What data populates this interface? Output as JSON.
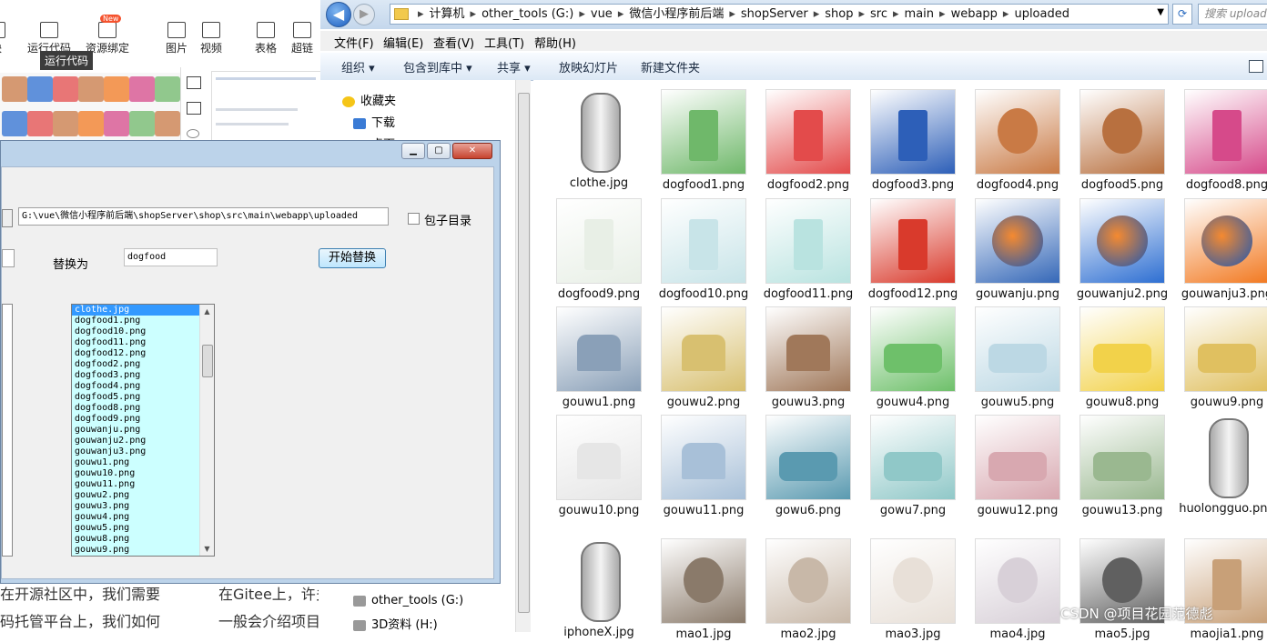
{
  "editor": {
    "toolbar": [
      {
        "label": "块",
        "icon": "block-icon"
      },
      {
        "label": "运行代码",
        "icon": "code-icon"
      },
      {
        "label": "资源绑定",
        "icon": "upload-icon",
        "badge": "New"
      },
      {
        "label": "图片",
        "icon": "image-icon"
      },
      {
        "label": "视频",
        "icon": "video-icon"
      },
      {
        "label": "表格",
        "icon": "table-icon"
      },
      {
        "label": "超链",
        "icon": "link-icon"
      }
    ],
    "tooltip": "运行代码",
    "text_left": [
      "在开源社区中，我们需要",
      "码托管平台上，我们如何"
    ],
    "text_mid": [
      "在Gitee上，许多",
      "一般会介绍项目"
    ]
  },
  "dialog": {
    "path_value": "G:\\vue\\微信小程序前后端\\shopServer\\shop\\src\\main\\webapp\\uploaded",
    "subdir_label": "包子目录",
    "replace_label": "替换为",
    "replace_value": "dogfood",
    "start_button": "开始替换",
    "file_list": [
      "clothe.jpg",
      "dogfood1.png",
      "dogfood10.png",
      "dogfood11.png",
      "dogfood12.png",
      "dogfood2.png",
      "dogfood3.png",
      "dogfood4.png",
      "dogfood5.png",
      "dogfood8.png",
      "dogfood9.png",
      "gouwanju.png",
      "gouwanju2.png",
      "gouwanju3.png",
      "gouwu1.png",
      "gouwu10.png",
      "gouwu11.png",
      "gouwu2.png",
      "gouwu3.png",
      "gouwu4.png",
      "gouwu5.png",
      "gouwu8.png",
      "gouwu9.png"
    ],
    "selected_index": 0
  },
  "explorer": {
    "breadcrumb": [
      "计算机",
      "other_tools (G:)",
      "vue",
      "微信小程序前后端",
      "shopServer",
      "shop",
      "src",
      "main",
      "webapp",
      "uploaded"
    ],
    "search_placeholder": "搜索 uploaded",
    "menu": [
      "文件(F)",
      "编辑(E)",
      "查看(V)",
      "工具(T)",
      "帮助(H)"
    ],
    "commands": [
      "组织 ▾",
      "包含到库中 ▾",
      "共享 ▾",
      "放映幻灯片",
      "新建文件夹"
    ],
    "nav": [
      {
        "label": "收藏夹",
        "icon": "star-icon"
      },
      {
        "label": "下载",
        "icon": "download-folder-icon"
      },
      {
        "label": "桌面",
        "icon": "desktop-icon"
      },
      {
        "label": "other_tools (G:)",
        "icon": "drive-icon"
      },
      {
        "label": "3D资料 (H:)",
        "icon": "drive-icon"
      }
    ],
    "files": [
      {
        "name": "clothe.jpg",
        "kind": "car"
      },
      {
        "name": "dogfood1.png",
        "kind": "food",
        "color": "#6fb86a"
      },
      {
        "name": "dogfood2.png",
        "kind": "food",
        "color": "#e34b4b"
      },
      {
        "name": "dogfood3.png",
        "kind": "food",
        "color": "#2d5fb8"
      },
      {
        "name": "dogfood4.png",
        "kind": "dog",
        "color": "#c97a45"
      },
      {
        "name": "dogfood5.png",
        "kind": "dog",
        "color": "#b8703f"
      },
      {
        "name": "dogfood8.png",
        "kind": "food",
        "color": "#d64a8a"
      },
      {
        "name": "dogfood9.png",
        "kind": "food",
        "color": "#e8efe6"
      },
      {
        "name": "dogfood10.png",
        "kind": "food",
        "color": "#c8e4e8"
      },
      {
        "name": "dogfood11.png",
        "kind": "food",
        "color": "#b9e3e0"
      },
      {
        "name": "dogfood12.png",
        "kind": "food",
        "color": "#d93a2c"
      },
      {
        "name": "gouwanju.png",
        "kind": "ball",
        "color": "#3568b8"
      },
      {
        "name": "gouwanju2.png",
        "kind": "ball",
        "color": "#2e6fd2"
      },
      {
        "name": "gouwanju3.png",
        "kind": "ball",
        "color": "#f27a22"
      },
      {
        "name": "gouwu1.png",
        "kind": "house",
        "color": "#8aa0b8"
      },
      {
        "name": "gouwu2.png",
        "kind": "house",
        "color": "#d8c070"
      },
      {
        "name": "gouwu3.png",
        "kind": "house",
        "color": "#a0785a"
      },
      {
        "name": "gouwu4.png",
        "kind": "bed",
        "color": "#6ec06a"
      },
      {
        "name": "gouwu5.png",
        "kind": "bed",
        "color": "#bcd8e4"
      },
      {
        "name": "gouwu8.png",
        "kind": "bed",
        "color": "#f2d24a"
      },
      {
        "name": "gouwu9.png",
        "kind": "bed",
        "color": "#e0c060"
      },
      {
        "name": "gouwu10.png",
        "kind": "house",
        "color": "#e6e6e6"
      },
      {
        "name": "gouwu11.png",
        "kind": "house",
        "color": "#a8c0d8"
      },
      {
        "name": "gowu6.png",
        "kind": "bed",
        "color": "#5a9ab0"
      },
      {
        "name": "gowu7.png",
        "kind": "bed",
        "color": "#90c8c8"
      },
      {
        "name": "gouwu12.png",
        "kind": "bed",
        "color": "#d8a8b0"
      },
      {
        "name": "gouwu13.png",
        "kind": "bed",
        "color": "#9ab890"
      },
      {
        "name": "huolongguo.png",
        "kind": "car"
      },
      {
        "name": "iphoneX.jpg",
        "kind": "car"
      },
      {
        "name": "mao1.jpg",
        "kind": "cat",
        "color": "#8a7a6a"
      },
      {
        "name": "mao2.jpg",
        "kind": "cat",
        "color": "#c8b8a8"
      },
      {
        "name": "mao3.jpg",
        "kind": "cat",
        "color": "#e8e0d8"
      },
      {
        "name": "mao4.jpg",
        "kind": "cat",
        "color": "#d8d0d8"
      },
      {
        "name": "mao5.jpg",
        "kind": "cat",
        "color": "#606060"
      },
      {
        "name": "maojia1.png",
        "kind": "food",
        "color": "#c8a078"
      }
    ]
  },
  "watermark": "CSDN @项目花园范德彪"
}
